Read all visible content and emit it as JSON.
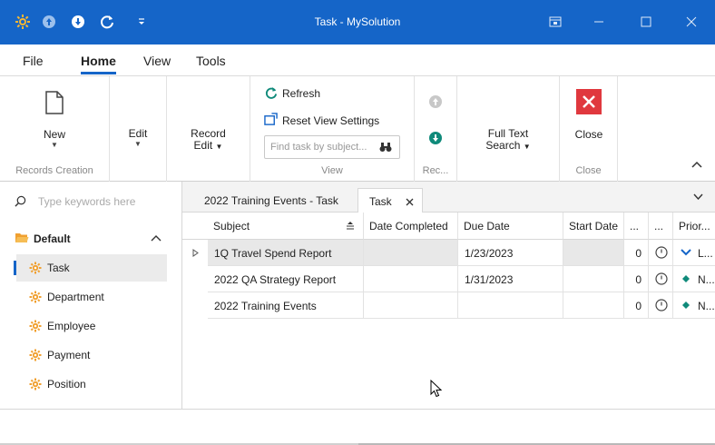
{
  "window": {
    "title": "Task - MySolution"
  },
  "menu": {
    "tabs": [
      "File",
      "Home",
      "View",
      "Tools"
    ]
  },
  "ribbon": {
    "new_label": "New",
    "records_creation_label": "Records Creation",
    "edit_label": "Edit",
    "record_edit_label_1": "Record",
    "record_edit_label_2": "Edit",
    "refresh_label": "Refresh",
    "reset_view_label": "Reset View Settings",
    "search_placeholder": "Find task by subject...",
    "view_group_label": "View",
    "rec_group_label": "Rec...",
    "full_text_label_1": "Full Text",
    "full_text_label_2": "Search",
    "close_label": "Close",
    "close_group_label": "Close"
  },
  "nav": {
    "search_placeholder": "Type keywords here",
    "group": "Default",
    "items": [
      "Task",
      "Department",
      "Employee",
      "Payment",
      "Position"
    ],
    "active": "Task"
  },
  "doc_tabs": {
    "tab1": "2022 Training Events - Task",
    "tab2": "Task"
  },
  "grid": {
    "columns": {
      "subject": "Subject",
      "date_completed": "Date Completed",
      "due_date": "Due Date",
      "start_date": "Start Date",
      "col5": "...",
      "col6": "...",
      "priority": "Prior..."
    },
    "rows": [
      {
        "subject": "1Q Travel Spend Report",
        "date_completed": "",
        "due_date": "1/23/2023",
        "start_date": "",
        "count": "0",
        "priority": "L..."
      },
      {
        "subject": "2022 QA Strategy Report",
        "date_completed": "",
        "due_date": "1/31/2023",
        "start_date": "",
        "count": "0",
        "priority": "N..."
      },
      {
        "subject": "2022 Training Events",
        "date_completed": "",
        "due_date": "",
        "start_date": "",
        "count": "0",
        "priority": "N..."
      }
    ]
  },
  "colors": {
    "accent": "#1565c8",
    "close_red": "#e0383e",
    "teal": "#0f8a7a",
    "gear_orange": "#f0a030"
  }
}
